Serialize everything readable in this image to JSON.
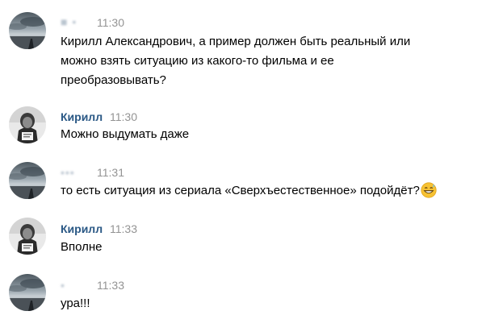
{
  "chat": {
    "messages": [
      {
        "author": "",
        "author_blurred": true,
        "time": "11:30",
        "avatar": "landscape-photo",
        "lines": [
          "Кирилл Александрович, а пример должен быть реальный или",
          "можно взять ситуацию из какого-то фильма и ее",
          "преобразовывать?"
        ]
      },
      {
        "author": "Кирилл",
        "author_blurred": false,
        "time": "11:30",
        "avatar": "person-photo",
        "lines": [
          "Можно выдумать даже"
        ]
      },
      {
        "author": "",
        "author_blurred": true,
        "time": "11:31",
        "avatar": "landscape-photo",
        "lines": [
          "то есть ситуация из сериала «Сверхъестественное» подойдёт?"
        ],
        "emoji": "grinning-sweat-emoji"
      },
      {
        "author": "Кирилл",
        "author_blurred": false,
        "time": "11:33",
        "avatar": "person-photo",
        "lines": [
          "Вполне"
        ]
      },
      {
        "author": "",
        "author_blurred": true,
        "time": "11:33",
        "avatar": "landscape-photo",
        "lines": [
          "ура!!!"
        ]
      }
    ]
  },
  "colors": {
    "author_link": "#2a5885",
    "time": "#939393",
    "text": "#000000"
  }
}
